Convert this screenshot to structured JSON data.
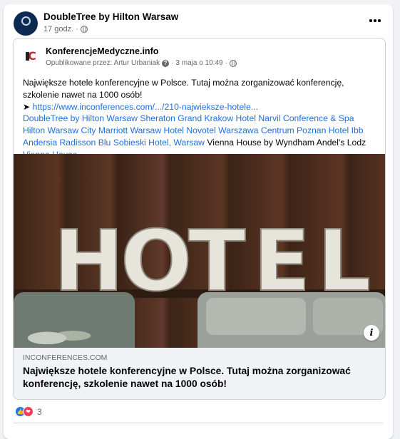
{
  "post": {
    "page_name": "DoubleTree by Hilton Warsaw",
    "time": "17 godz.",
    "privacy_icon": "globe-icon",
    "more_icon": "more-dots-icon"
  },
  "shared": {
    "page_name": "KonferencjeMedyczne.info",
    "meta_prefix": "Opublikowane przez: Artur Urbaniak",
    "date": "3 maja o 10:49",
    "text_line": "Największe hotele konferencyjne w Polsce. Tutaj można zorganizować konferencję, szkolenie nawet na 1000 osób!",
    "arrow": "➤",
    "url": "https://www.inconferences.com/.../210-najwieksze-hotele...",
    "hotels": [
      {
        "t": "DoubleTree by Hilton Warsaw",
        "link": true
      },
      {
        "t": "Sheraton Grand Krakow",
        "link": true
      },
      {
        "t": "Hotel Narvil Conference & Spa",
        "link": true
      },
      {
        "t": "Hilton Warsaw City",
        "link": true
      },
      {
        "t": "Marriott Warsaw",
        "link": true
      },
      {
        "t": "Hotel Novotel Warszawa Centrum",
        "link": true
      },
      {
        "t": "Poznan Hotel",
        "link": true
      },
      {
        "t": "Ibb Andersia",
        "link": true
      },
      {
        "t": "Radisson Blu Sobieski Hotel, Warsaw",
        "link": true
      },
      {
        "t": "Vienna House by Wyndham Andel's Lodz",
        "link": false
      },
      {
        "t": "Vienna House",
        "link": true
      }
    ],
    "photo_letters": [
      "H",
      "O",
      "T",
      "E",
      "L"
    ],
    "link_domain": "INCONFERENCES.COM",
    "link_title": "Największe hotele konferencyjne w Polsce. Tutaj można zorganizować konferencję, szkolenie nawet na 1000 osób!"
  },
  "reactions": {
    "count": "3",
    "types": [
      "like-icon",
      "love-icon"
    ]
  },
  "colors": {
    "link": "#216fdb",
    "like": "#1877f2",
    "love": "#f33e58"
  }
}
